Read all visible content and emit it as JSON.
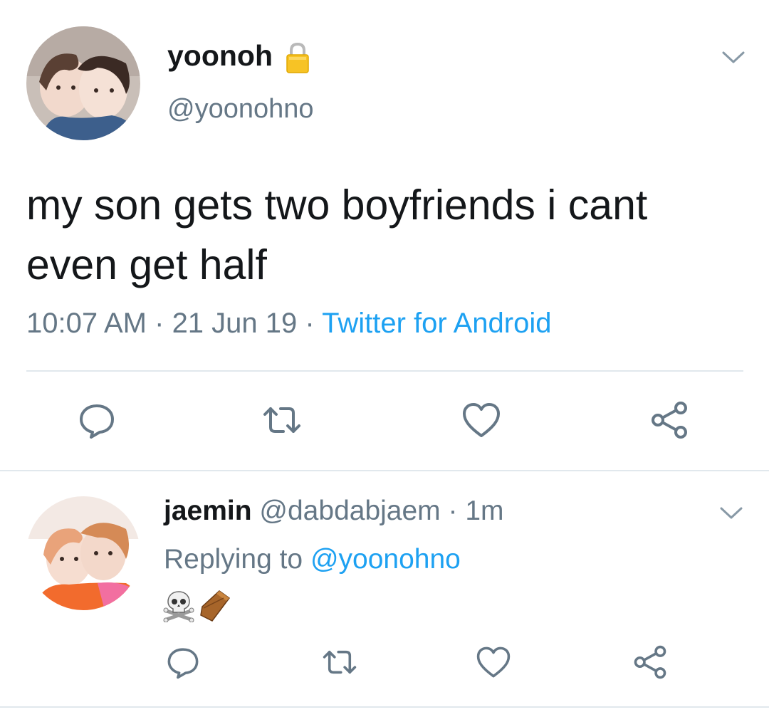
{
  "colors": {
    "text_primary": "#14171a",
    "text_secondary": "#657786",
    "link": "#1da1f2",
    "divider": "#e1e8ed"
  },
  "main_tweet": {
    "display_name": "yoonoh",
    "handle": "@yoonohno",
    "protected_icon": "lock-icon",
    "text": "my son gets two boyfriends i cant even get half",
    "time": "10:07 AM",
    "separator": " · ",
    "date": "21 Jun 19",
    "source": "Twitter for Android",
    "menu_icon": "chevron-down-icon",
    "actions": [
      "reply-icon",
      "retweet-icon",
      "like-icon",
      "share-icon"
    ]
  },
  "reply_tweet": {
    "display_name": "jaemin",
    "handle": "@dabdabjaem",
    "separator": " · ",
    "time_ago": "1m",
    "replying_prefix": "Replying to ",
    "replying_handle": "@yoonohno",
    "emojis": [
      "skull-and-crossbones-emoji",
      "coffin-emoji"
    ],
    "menu_icon": "chevron-down-icon",
    "actions": [
      "reply-icon",
      "retweet-icon",
      "like-icon",
      "share-icon"
    ]
  }
}
